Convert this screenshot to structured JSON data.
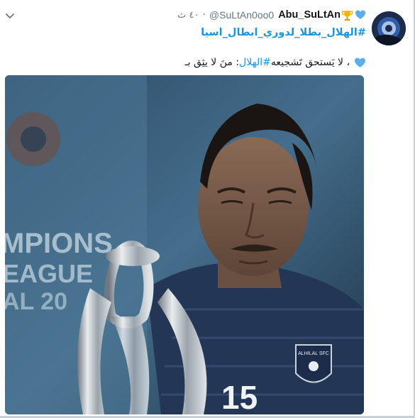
{
  "tweet": {
    "display_name": "Abu_SuLtAn",
    "handle": "@SuLtAn0oo0",
    "separator": "·",
    "time": "٤٠ ث",
    "hashtag_line": "#الهلال_بطلا_لدوري_ابطال_اسيا",
    "text_part1": ": منَ لا يثِق بـ ",
    "text_mention": "#الهلال",
    "text_part2": " ، لا يَستحق تَشجيعه"
  },
  "photo": {
    "banner_line1": "MPIONS",
    "banner_line2": "EAGUE",
    "banner_line3": "AL 20",
    "jersey_number": "15",
    "crest_text": "ALHILAL SFC"
  },
  "icons": {
    "menu": "chevron-down-icon",
    "name_emoji_1": "blue-heart-icon",
    "name_emoji_2": "trophy-icon",
    "text_emoji": "blue-heart-icon"
  },
  "colors": {
    "link": "#1b95e0",
    "muted": "#657786",
    "text": "#14171a",
    "heart": "#5dadec",
    "trophy": "#f4b400"
  }
}
